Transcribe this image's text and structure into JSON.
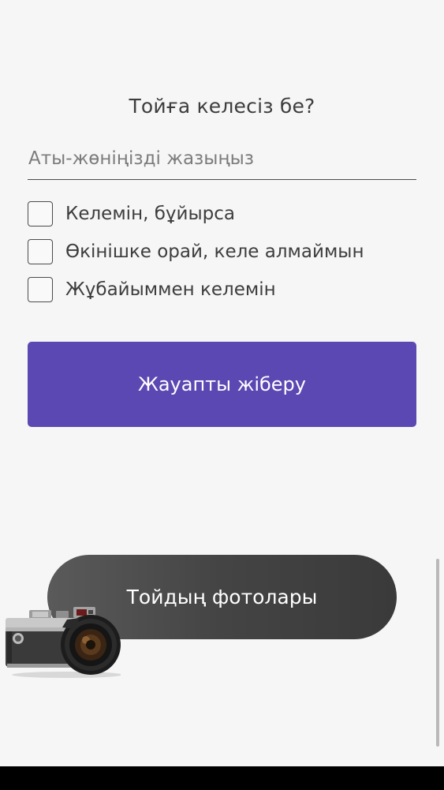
{
  "form": {
    "question": "Тойға келесіз бе?",
    "name_placeholder": "Аты-жөніңізді жазыңыз",
    "name_value": "",
    "options": [
      {
        "label": "Келемін, бұйырса",
        "checked": false
      },
      {
        "label": "Өкінішке орай, келе алмаймын",
        "checked": false
      },
      {
        "label": "Жұбайыммен келемін",
        "checked": false
      }
    ],
    "submit_label": "Жауапты жіберу"
  },
  "photos": {
    "button_label": "Тойдың фотолары",
    "icon": "camera-icon"
  },
  "colors": {
    "background": "#f6f6f6",
    "accent": "#5c48b2",
    "dark_button": "#444444",
    "text": "#3d3d3d"
  }
}
